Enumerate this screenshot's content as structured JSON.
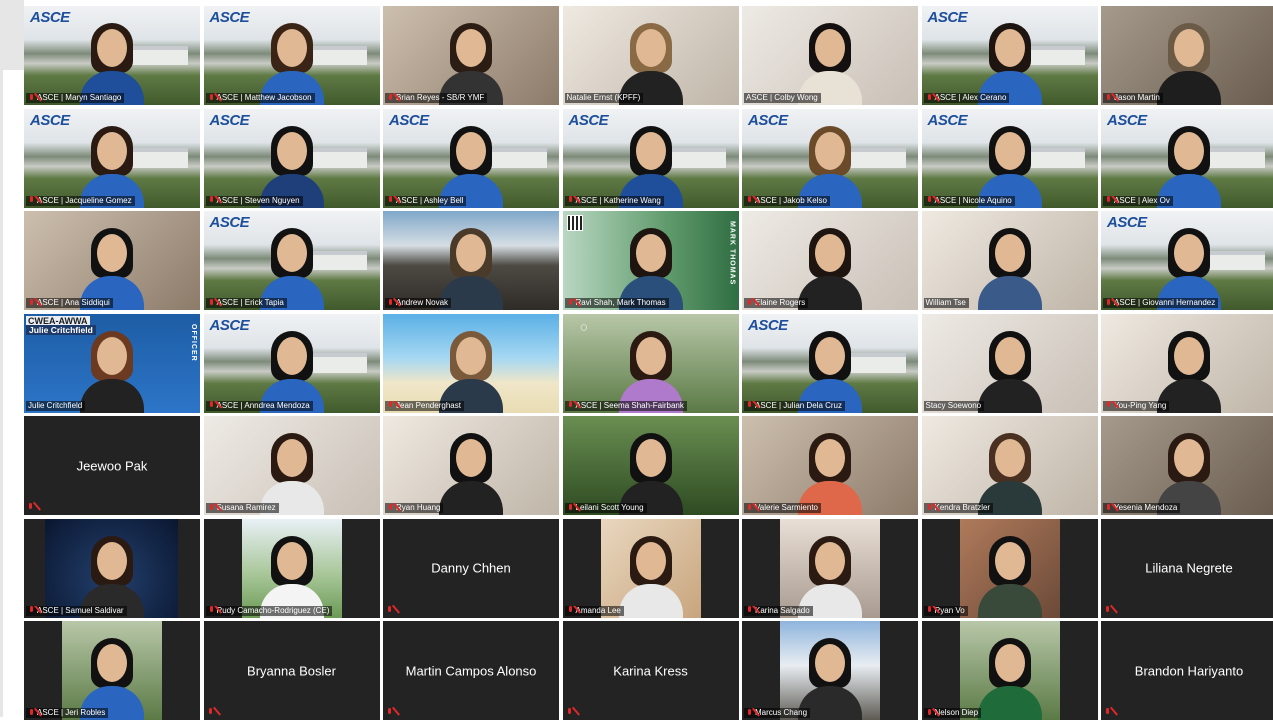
{
  "colors": {
    "tile_bg": "#232323",
    "active_speaker_border": "#a6e22e",
    "muted_mic": "#e02828",
    "asce_blue": "#1d4f9c"
  },
  "tiles": [
    {
      "name": "ASCE | Maryn Santiago",
      "bg": "campus",
      "asce": true,
      "hair": "#2a1a12",
      "shirt": "#1f4f9a"
    },
    {
      "name": "ASCE | Matthew Jacobson",
      "bg": "campus",
      "asce": true,
      "hair": "#3a2415",
      "shirt": "#2a66c0"
    },
    {
      "name": "Brian Reyes - SB/R YMF",
      "bg": "room1",
      "hair": "#2b1c14",
      "shirt": "#333333"
    },
    {
      "name": "Natalie Ernst (KPFF)",
      "bg": "room2",
      "hair": "#8a6a45",
      "shirt": "#222222",
      "mic_on": true
    },
    {
      "name": "ASCE | Colby Wong",
      "bg": "room4",
      "hair": "#151010",
      "shirt": "#e8e1d6",
      "active": true,
      "mic_on": true
    },
    {
      "name": "ASCE | Alex Cerano",
      "bg": "campus",
      "asce": true,
      "hair": "#1e1410",
      "shirt": "#2a66c0"
    },
    {
      "name": "Jason Martin",
      "bg": "room3",
      "hair": "#6b5a45",
      "shirt": "#1e1e1e"
    },
    {
      "name": "ASCE | Jacqueline Gomez",
      "bg": "campus",
      "asce": true,
      "hair": "#2a1a12",
      "shirt": "#2a66c0"
    },
    {
      "name": "ASCE | Steven Nguyen",
      "bg": "campus",
      "asce": true,
      "hair": "#111111",
      "shirt": "#1f3f7a"
    },
    {
      "name": "ASCE | Ashley Bell",
      "bg": "campus",
      "asce": true,
      "hair": "#111111",
      "shirt": "#2a66c0"
    },
    {
      "name": "ASCE | Katherine Wang",
      "bg": "campus",
      "asce": true,
      "hair": "#111111",
      "shirt": "#1f4f9a"
    },
    {
      "name": "ASCE | Jakob Kelso",
      "bg": "campus",
      "asce": true,
      "hair": "#6b4a2a",
      "shirt": "#2a66c0"
    },
    {
      "name": "ASCE | Nicole Aquino",
      "bg": "campus",
      "asce": true,
      "hair": "#111111",
      "shirt": "#2a66c0"
    },
    {
      "name": "ASCE | Alex Ov",
      "bg": "campus",
      "asce": true,
      "hair": "#111111",
      "shirt": "#2a66c0"
    },
    {
      "name": "ASCE | Ana Siddiqui",
      "bg": "room1",
      "hair": "#111111",
      "shirt": "#2a66c0"
    },
    {
      "name": "ASCE | Erick Tapia",
      "bg": "campus",
      "asce": true,
      "hair": "#111111",
      "shirt": "#2a66c0"
    },
    {
      "name": "Andrew Novak",
      "bg": "mountain",
      "hair": "#4a3a2a",
      "shirt": "#2a3a4a"
    },
    {
      "name": "Ravi Shah, Mark Thomas",
      "bg": "green",
      "hair": "#1e1410",
      "shirt": "#2a4f7a",
      "qr": true,
      "side_text": "MARK THOMAS"
    },
    {
      "name": "Elaine Rogers",
      "bg": "room4",
      "hair": "#1e1410",
      "shirt": "#222222"
    },
    {
      "name": "William Tse",
      "bg": "room2",
      "hair": "#111111",
      "shirt": "#3a5a8a",
      "mic_on": true
    },
    {
      "name": "ASCE | Giovanni Hernandez",
      "bg": "campus",
      "asce": true,
      "hair": "#111111",
      "shirt": "#2a66c0"
    },
    {
      "name": "Julie Critchfield",
      "bg": "blue",
      "hair": "#6b3a20",
      "shirt": "#222222",
      "mic_on": true,
      "banner_top": "CWEA-AWWA",
      "banner_name": "Julie Critchfield",
      "side_text": "OFFICER"
    },
    {
      "name": "ASCE | Anndrea Mendoza",
      "bg": "campus",
      "asce": true,
      "hair": "#111111",
      "shirt": "#2a66c0"
    },
    {
      "name": "Jean Penderghast",
      "bg": "beach",
      "hair": "#7a5a3a",
      "shirt": "#2a3a4a"
    },
    {
      "name": "ASCE | Seema Shah-Fairbank",
      "bg": "park",
      "hair": "#2a1a12",
      "shirt": "#b07acc",
      "logo": true
    },
    {
      "name": "ASCE | Julian Dela Cruz",
      "bg": "campus",
      "asce": true,
      "hair": "#111111",
      "shirt": "#2a66c0"
    },
    {
      "name": "Stacy Soewono",
      "bg": "room4",
      "hair": "#111111",
      "shirt": "#222222",
      "mic_on": true
    },
    {
      "name": "You-Ping Yang",
      "bg": "room2",
      "hair": "#111111",
      "shirt": "#222222"
    },
    {
      "name": "Jeewoo Pak",
      "empty": true
    },
    {
      "name": "Susana Ramirez",
      "bg": "room4",
      "hair": "#2a1a12",
      "shirt": "#e8e8e8"
    },
    {
      "name": "Ryan Huang",
      "bg": "room2",
      "hair": "#111111",
      "shirt": "#222222"
    },
    {
      "name": "Leilani Scott Young",
      "bg": "fair",
      "hair": "#111111",
      "shirt": "#222222"
    },
    {
      "name": "Valerie Sarmiento",
      "bg": "room1",
      "hair": "#2a1a12",
      "shirt": "#e0684a"
    },
    {
      "name": "Kendra Bratzler",
      "bg": "room2",
      "hair": "#4a3020",
      "shirt": "#2a3a3a"
    },
    {
      "name": "Yesenia Mendoza",
      "bg": "room3",
      "hair": "#2a1a12",
      "shirt": "#444444"
    },
    {
      "name": "ASCE | Samuel Saldivar",
      "bg": "space",
      "inset": "w133",
      "hair": "#2a1a12",
      "shirt": "#2a2a2a"
    },
    {
      "name": "Rudy Camacho-Rodriguez (CE)",
      "bg": "golf",
      "inset": "w100",
      "hair": "#111111",
      "shirt": "#f4f4f4"
    },
    {
      "name": "Danny Chhen",
      "empty": true
    },
    {
      "name": "Amanda Lee",
      "bg": "dog",
      "inset": "w100",
      "hair": "#2a1a12",
      "shirt": "#e8e8e8"
    },
    {
      "name": "Karina Salgado",
      "bg": "sunset",
      "inset": "w100",
      "hair": "#2a1a12",
      "shirt": "#e8e8e8"
    },
    {
      "name": "Ryan Vo",
      "bg": "rock",
      "inset": "w100",
      "hair": "#111111",
      "shirt": "#3a4a3a"
    },
    {
      "name": "Liliana Negrete",
      "empty": true
    },
    {
      "name": "ASCE | Jeri Robles",
      "bg": "park",
      "inset": "w100",
      "hair": "#111111",
      "shirt": "#2a66c0"
    },
    {
      "name": "Bryanna Bosler",
      "empty": true
    },
    {
      "name": "Martin Campos Alonso",
      "empty": true
    },
    {
      "name": "Karina Kress",
      "empty": true
    },
    {
      "name": "Marcus Chang",
      "bg": "snow",
      "inset": "w100",
      "hair": "#111111",
      "shirt": "#2a2a2a"
    },
    {
      "name": "Nelson Diep",
      "bg": "park",
      "inset": "w100",
      "hair": "#111111",
      "shirt": "#1f6b3a"
    },
    {
      "name": "Brandon Hariyanto",
      "empty": true
    }
  ]
}
